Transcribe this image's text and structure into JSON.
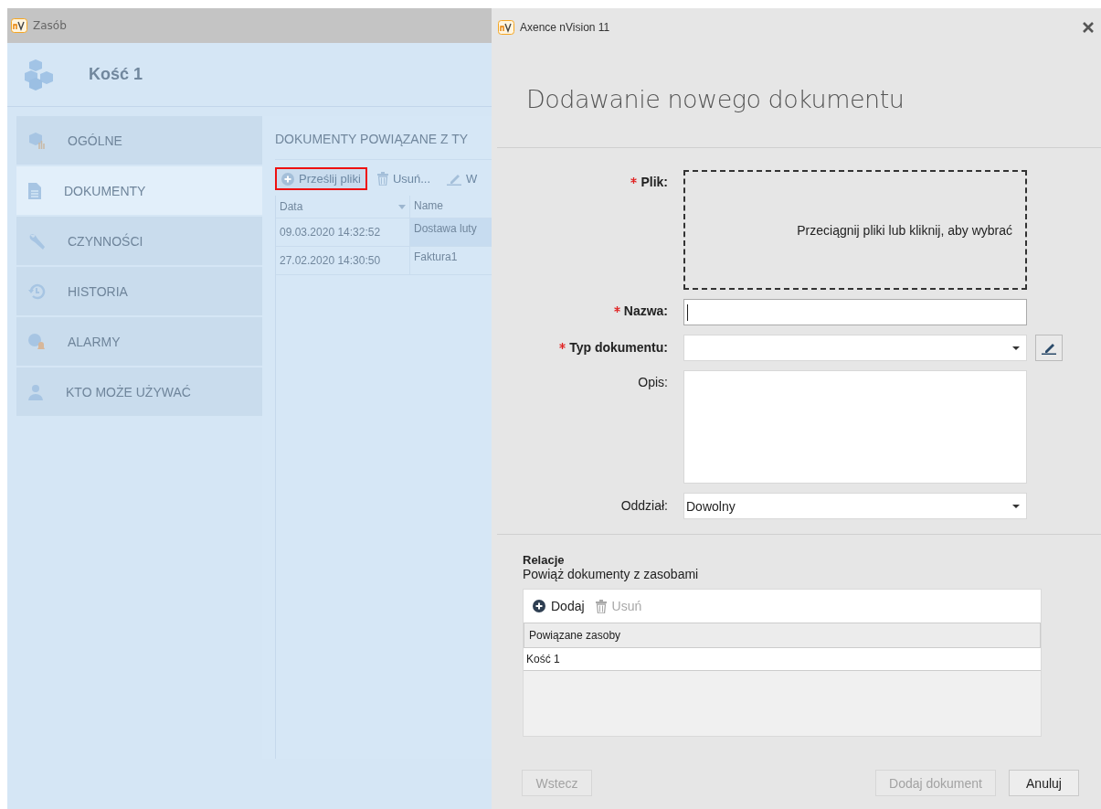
{
  "background_window": {
    "title": "Zasób",
    "header": "Kość 1",
    "nav": [
      {
        "label": "OGÓLNE",
        "selected": false
      },
      {
        "label": "DOKUMENTY",
        "selected": true
      },
      {
        "label": "CZYNNOŚCI",
        "selected": false
      },
      {
        "label": "HISTORIA",
        "selected": false
      },
      {
        "label": "ALARMY",
        "selected": false
      },
      {
        "label": "KTO MOŻE UŻYWAĆ",
        "selected": false
      }
    ],
    "section_title": "DOKUMENTY POWIĄZANE Z TY",
    "toolbar": [
      {
        "kind": "add",
        "label": "Prześlij pliki",
        "highlighted": true
      },
      {
        "kind": "delete",
        "label": "Usuń...",
        "highlighted": false
      },
      {
        "kind": "edit",
        "label": "W",
        "highlighted": false
      }
    ],
    "table": {
      "columns": [
        {
          "label": "Data",
          "sorted": true
        },
        {
          "label": "Name",
          "sorted": false
        }
      ],
      "rows": [
        {
          "cells": [
            "09.03.2020 14:32:52",
            "Dostawa luty"
          ],
          "selected": true
        },
        {
          "cells": [
            "27.02.2020 14:30:50",
            "Faktura1"
          ],
          "selected": false
        }
      ]
    }
  },
  "dialog": {
    "title": "Axence nVision 11",
    "heading": "Dodawanie nowego dokumentu",
    "fields": [
      {
        "kind": "dropzone",
        "label": "Plik:",
        "required": true,
        "text": "Przeciągnij pliki lub kliknij, aby wybrać"
      },
      {
        "kind": "text",
        "label": "Nazwa:",
        "required": true,
        "focused": true
      },
      {
        "kind": "select",
        "label": "Typ dokumentu:",
        "required": true,
        "editable": true
      },
      {
        "kind": "textarea",
        "label": "Opis:",
        "required": false
      },
      {
        "kind": "select",
        "label": "Oddział:",
        "required": false,
        "value": "Dowolny",
        "editable": false
      }
    ],
    "relations": {
      "title": "Relacje",
      "subtitle": "Powiąż dokumenty z zasobami",
      "toolbar": [
        {
          "kind": "add",
          "label": "Dodaj",
          "disabled": false
        },
        {
          "kind": "delete",
          "label": "Usuń",
          "disabled": true
        }
      ],
      "column": "Powiązane zasoby",
      "rows": [
        "Kość 1"
      ]
    },
    "buttons_left": [
      {
        "label": "Wstecz",
        "disabled": true
      }
    ],
    "buttons_right": [
      {
        "label": "Dodaj dokument",
        "disabled": true
      },
      {
        "label": "Anuluj",
        "disabled": false
      }
    ]
  }
}
